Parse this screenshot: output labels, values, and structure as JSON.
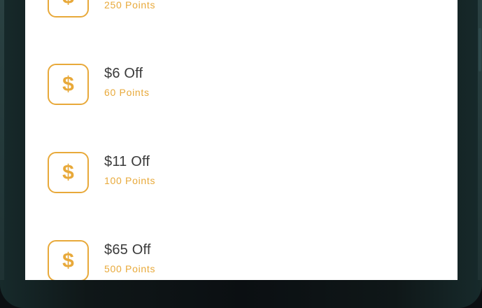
{
  "rewards": [
    {
      "title": "",
      "points": "250 Points",
      "icon": "dollar-sign-icon",
      "icon_symbol": "$"
    },
    {
      "title": "$6 Off",
      "points": "60 Points",
      "icon": "dollar-sign-icon",
      "icon_symbol": "$"
    },
    {
      "title": "$11 Off",
      "points": "100 Points",
      "icon": "dollar-sign-icon",
      "icon_symbol": "$"
    },
    {
      "title": "$65 Off",
      "points": "500 Points",
      "icon": "dollar-sign-icon",
      "icon_symbol": "$"
    }
  ],
  "colors": {
    "accent": "#e8a93a",
    "title_text": "#3a3a3a",
    "screen_background": "#ffffff",
    "device_frame": "#0b0f12"
  }
}
